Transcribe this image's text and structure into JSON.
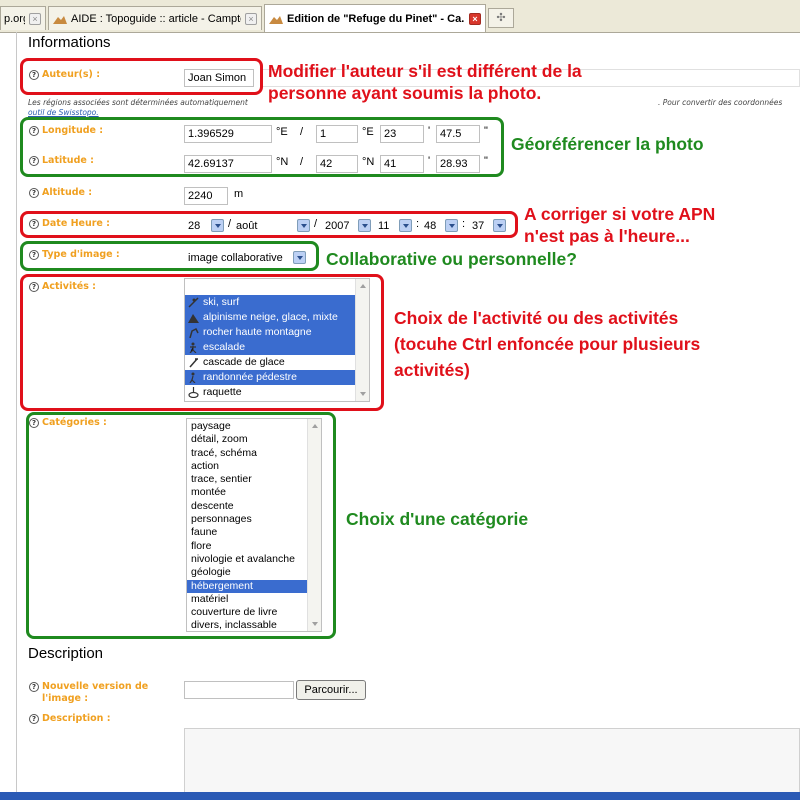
{
  "tabs": [
    {
      "label": "p.org"
    },
    {
      "label": "AIDE : Topoguide :: article - Camptoca..."
    },
    {
      "label": "Edition de \"Refuge du Pinet\" - Ca...",
      "active": true
    }
  ],
  "sections": {
    "informations": "Informations",
    "description": "Description"
  },
  "fields": {
    "auteur": {
      "label": "Auteur(s) :",
      "value": "Joan Simon"
    },
    "longitude": {
      "label": "Longitude :",
      "decimal": "1.396529",
      "deg_unit": "°E",
      "slash": "/",
      "deg": "1",
      "deg_unit2": "°E",
      "min": "23",
      "min_unit": "'",
      "sec": "47.5",
      "sec_unit": "\""
    },
    "latitude": {
      "label": "Latitude :",
      "decimal": "42.69137",
      "deg_unit": "°N",
      "slash": "/",
      "deg": "42",
      "deg_unit2": "°N",
      "min": "41",
      "min_unit": "'",
      "sec": "28.93",
      "sec_unit": "\""
    },
    "altitude": {
      "label": "Altitude :",
      "value": "2240",
      "unit": "m"
    },
    "date": {
      "label": "Date Heure :",
      "day": "28",
      "month": "août",
      "year": "2007",
      "hour": "11",
      "minute": "48",
      "second": "37",
      "sep1": "/",
      "sep2": "/",
      "sep3": ":",
      "sep4": ":"
    },
    "type": {
      "label": "Type d'image :",
      "value": "image collaborative"
    },
    "activites": {
      "label": "Activités :",
      "options": [
        {
          "label": "ski, surf",
          "selected": true
        },
        {
          "label": "alpinisme neige, glace, mixte",
          "selected": true
        },
        {
          "label": "rocher haute montagne",
          "selected": true
        },
        {
          "label": "escalade",
          "selected": true
        },
        {
          "label": "cascade de glace",
          "selected": false
        },
        {
          "label": "randonnée pédestre",
          "selected": true
        },
        {
          "label": "raquette",
          "selected": false
        }
      ]
    },
    "categories": {
      "label": "Catégories :",
      "options": [
        {
          "label": "paysage",
          "selected": false
        },
        {
          "label": "détail, zoom",
          "selected": false
        },
        {
          "label": "tracé, schéma",
          "selected": false
        },
        {
          "label": "action",
          "selected": false
        },
        {
          "label": "trace, sentier",
          "selected": false
        },
        {
          "label": "montée",
          "selected": false
        },
        {
          "label": "descente",
          "selected": false
        },
        {
          "label": "personnages",
          "selected": false
        },
        {
          "label": "faune",
          "selected": false
        },
        {
          "label": "flore",
          "selected": false
        },
        {
          "label": "nivologie et avalanche",
          "selected": false
        },
        {
          "label": "géologie",
          "selected": false
        },
        {
          "label": "hébergement",
          "selected": true
        },
        {
          "label": "matériel",
          "selected": false
        },
        {
          "label": "couverture de livre",
          "selected": false
        },
        {
          "label": "divers, inclassable",
          "selected": false
        }
      ]
    },
    "nouvelle_version": {
      "label1": "Nouvelle version de",
      "label2": "l'image :",
      "button": "Parcourir..."
    },
    "description": {
      "label": "Description :"
    }
  },
  "notes": {
    "line1": "Les régions associées sont déterminées automatiquement",
    "line2": "outil de Swisstopo.",
    "line3": ". Pour convertir des coordonnées"
  },
  "annotations": {
    "auteur": [
      "Modifier l'auteur s'il est différent de la",
      "personne ayant soumis la photo."
    ],
    "geo": "Géoréférencer la photo",
    "date": [
      "A corriger si votre APN",
      "n'est pas à l'heure..."
    ],
    "type": "Collaborative ou personnelle?",
    "activites": [
      "Choix de l'activité ou des activités",
      "(tocuhe Ctrl enfoncée pour plusieurs",
      "activités)"
    ],
    "categorie": "Choix d'une catégorie"
  },
  "colors": {
    "label": "#f0a020",
    "red": "#e0101a",
    "green": "#1f8a1f",
    "selection": "#3a6ccf"
  }
}
